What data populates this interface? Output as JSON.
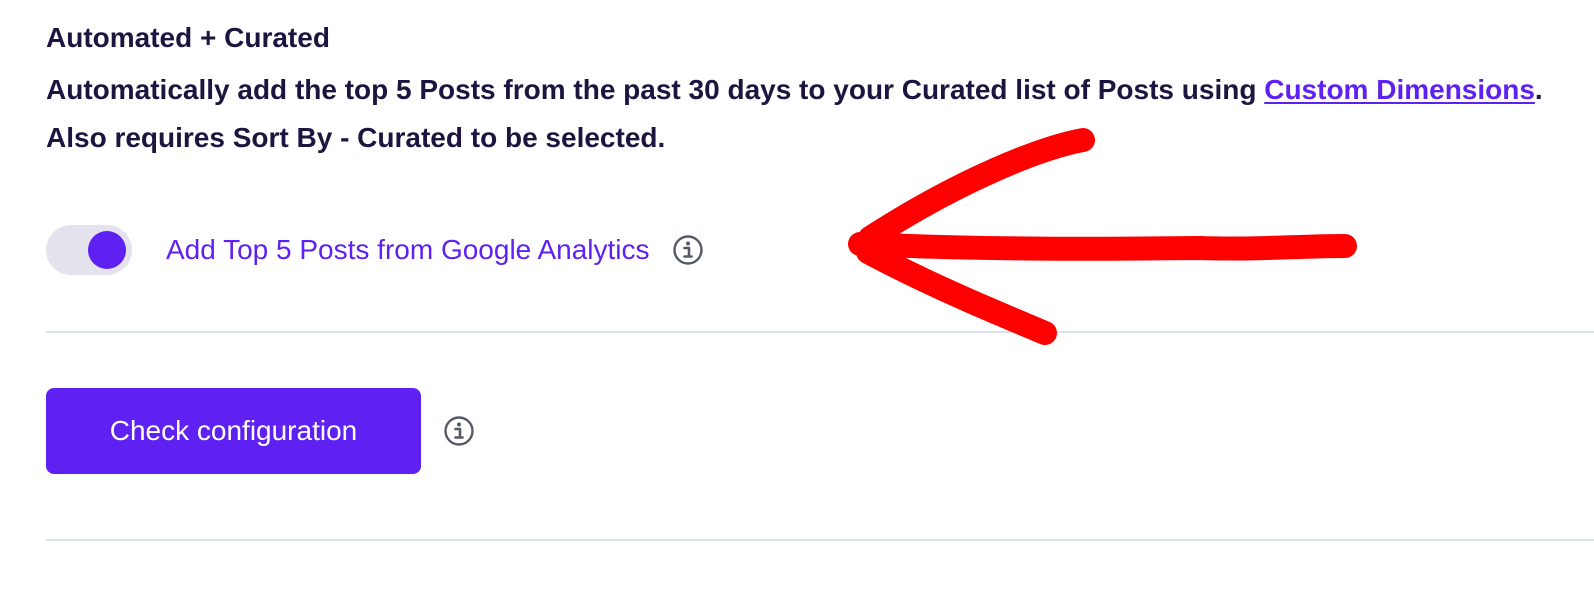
{
  "section": {
    "title": "Automated + Curated",
    "description_before_link": "Automatically add the top 5 Posts from the past 30 days to your Curated list of Posts using ",
    "link_text": "Custom Dimensions",
    "description_after_link": ". Also requires Sort By - Curated to be selected."
  },
  "toggle": {
    "label": "Add Top 5 Posts from Google Analytics",
    "enabled": true,
    "icon": "info-icon"
  },
  "actions": {
    "check_button_label": "Check configuration",
    "icon": "info-icon"
  },
  "colors": {
    "accent": "#5f21f2",
    "heading_text": "#1d1540",
    "toggle_track": "#e4e2ec",
    "divider": "#dce3ec",
    "annotation_arrow": "#ff0000"
  }
}
